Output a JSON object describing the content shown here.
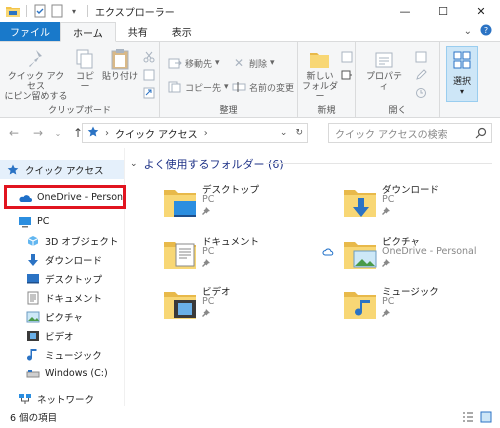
{
  "window": {
    "title": "エクスプローラー",
    "controls": {
      "minimize": "—",
      "maximize": "☐",
      "close": "✕"
    }
  },
  "ribbon_tabs": [
    "ファイル",
    "ホーム",
    "共有",
    "表示"
  ],
  "ribbon": {
    "clipboard": {
      "pin_line1": "クイック アクセス",
      "pin_line2": "にピン留めする",
      "copy": "コピー",
      "paste": "貼り付け",
      "label": "クリップボード"
    },
    "organize": {
      "move": "移動先",
      "copy_to": "コピー先",
      "delete": "削除",
      "rename": "名前の変更",
      "label": "整理"
    },
    "new": {
      "folder_line1": "新しい",
      "folder_line2": "フォルダー",
      "label": "新規"
    },
    "open": {
      "properties": "プロパティ",
      "label": "開く"
    },
    "select": {
      "label": "選択"
    }
  },
  "address": {
    "path": "クイック アクセス",
    "search_placeholder": "クイック アクセスの検索"
  },
  "nav": {
    "quick_access": "クイック アクセス",
    "onedrive": "OneDrive - Personal",
    "pc": "PC",
    "objects3d": "3D オブジェクト",
    "downloads": "ダウンロード",
    "desktop": "デスクトップ",
    "documents": "ドキュメント",
    "pictures": "ピクチャ",
    "videos": "ビデオ",
    "music": "ミュージック",
    "windows_c": "Windows (C:)",
    "network": "ネットワーク"
  },
  "content": {
    "section_title": "よく使用するフォルダー (6)",
    "folders": [
      {
        "name": "デスクトップ",
        "location": "PC"
      },
      {
        "name": "ダウンロード",
        "location": "PC"
      },
      {
        "name": "ドキュメント",
        "location": "PC"
      },
      {
        "name": "ピクチャ",
        "location": "OneDrive - Personal"
      },
      {
        "name": "ビデオ",
        "location": "PC"
      },
      {
        "name": "ミュージック",
        "location": "PC"
      }
    ]
  },
  "status": {
    "item_count": "6 個の項目"
  },
  "colors": {
    "accent": "#1979ca",
    "highlight_box": "#e1141f",
    "folder": "#f8d775",
    "section_title": "#1e3287"
  }
}
